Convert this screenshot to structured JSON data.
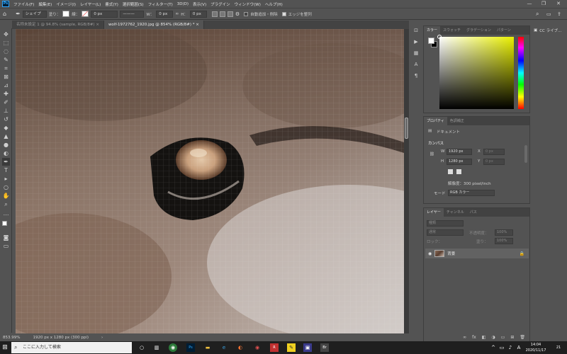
{
  "menubar": {
    "logo": "Ps",
    "items": [
      "ファイル(F)",
      "編集(E)",
      "イメージ(I)",
      "レイヤー(L)",
      "書式(Y)",
      "選択範囲(S)",
      "フィルター(T)",
      "3D(D)",
      "表示(V)",
      "プラグイン",
      "ウィンドウ(W)",
      "ヘルプ(H)"
    ],
    "minimize": "—",
    "maximize": "❐",
    "close": "✕"
  },
  "options": {
    "mode": "シェイプ",
    "fill_label": "塗り：",
    "stroke_label": "線：",
    "stroke_width": "0 px",
    "w_label": "W：",
    "w_value": "0 px",
    "h_label": "H：",
    "h_value": "0 px",
    "auto_add_delete": "自動追加・削除",
    "align_edges": "エッジを整列"
  },
  "tabs": [
    {
      "label": "名称未設定 1 @ 94.8% (sample, RGB/8#) ×",
      "active": false
    },
    {
      "label": "wolf-1972762_1920.jpg @ 854% (RGB/8#) * ×",
      "active": true
    }
  ],
  "status": {
    "zoom": "853.99%",
    "doc_size": "1920 px x 1280 px (300 ppi)",
    "arrow": "›"
  },
  "color_panel": {
    "tabs": [
      "カラー",
      "スウォッチ",
      "グラデーション",
      "パターン"
    ]
  },
  "properties_panel": {
    "tabs": [
      "プロパティ",
      "色調補正"
    ],
    "doc_label": "ドキュメント",
    "canvas_heading": "カンバス",
    "w_label": "W",
    "w_value": "1920 px",
    "x_label": "X",
    "x_placeholder": "0 px",
    "h_label": "H",
    "h_value": "1280 px",
    "y_label": "Y",
    "y_placeholder": "0 px",
    "resolution": "解像度：300 pixel/inch",
    "mode_label": "モード",
    "mode_value": "RGB カラー"
  },
  "layers_panel": {
    "tabs": [
      "レイヤー",
      "チャンネル",
      "パス"
    ],
    "kind_placeholder": "種類",
    "blend_mode": "通常",
    "opacity_label": "不透明度：",
    "opacity_value": "100%",
    "lock_label": "ロック：",
    "fill_label": "塗り：",
    "fill_value": "100%",
    "layer_name": "背景",
    "footer_icons": [
      "∞",
      "fx",
      "◧",
      "◑",
      "▭",
      "⊞",
      "🗑"
    ]
  },
  "cc_library": {
    "label": "CC ライブ..."
  },
  "taskbar": {
    "search_placeholder": "ここに入力して検索",
    "time": "14:04",
    "date": "2020/11/17",
    "ime": "A",
    "notifications": "21"
  },
  "colors": {
    "ui_bg": "#535353",
    "ui_dark": "#424242",
    "accent": "#31a8ff",
    "taskbar": "#1f1f1f"
  }
}
